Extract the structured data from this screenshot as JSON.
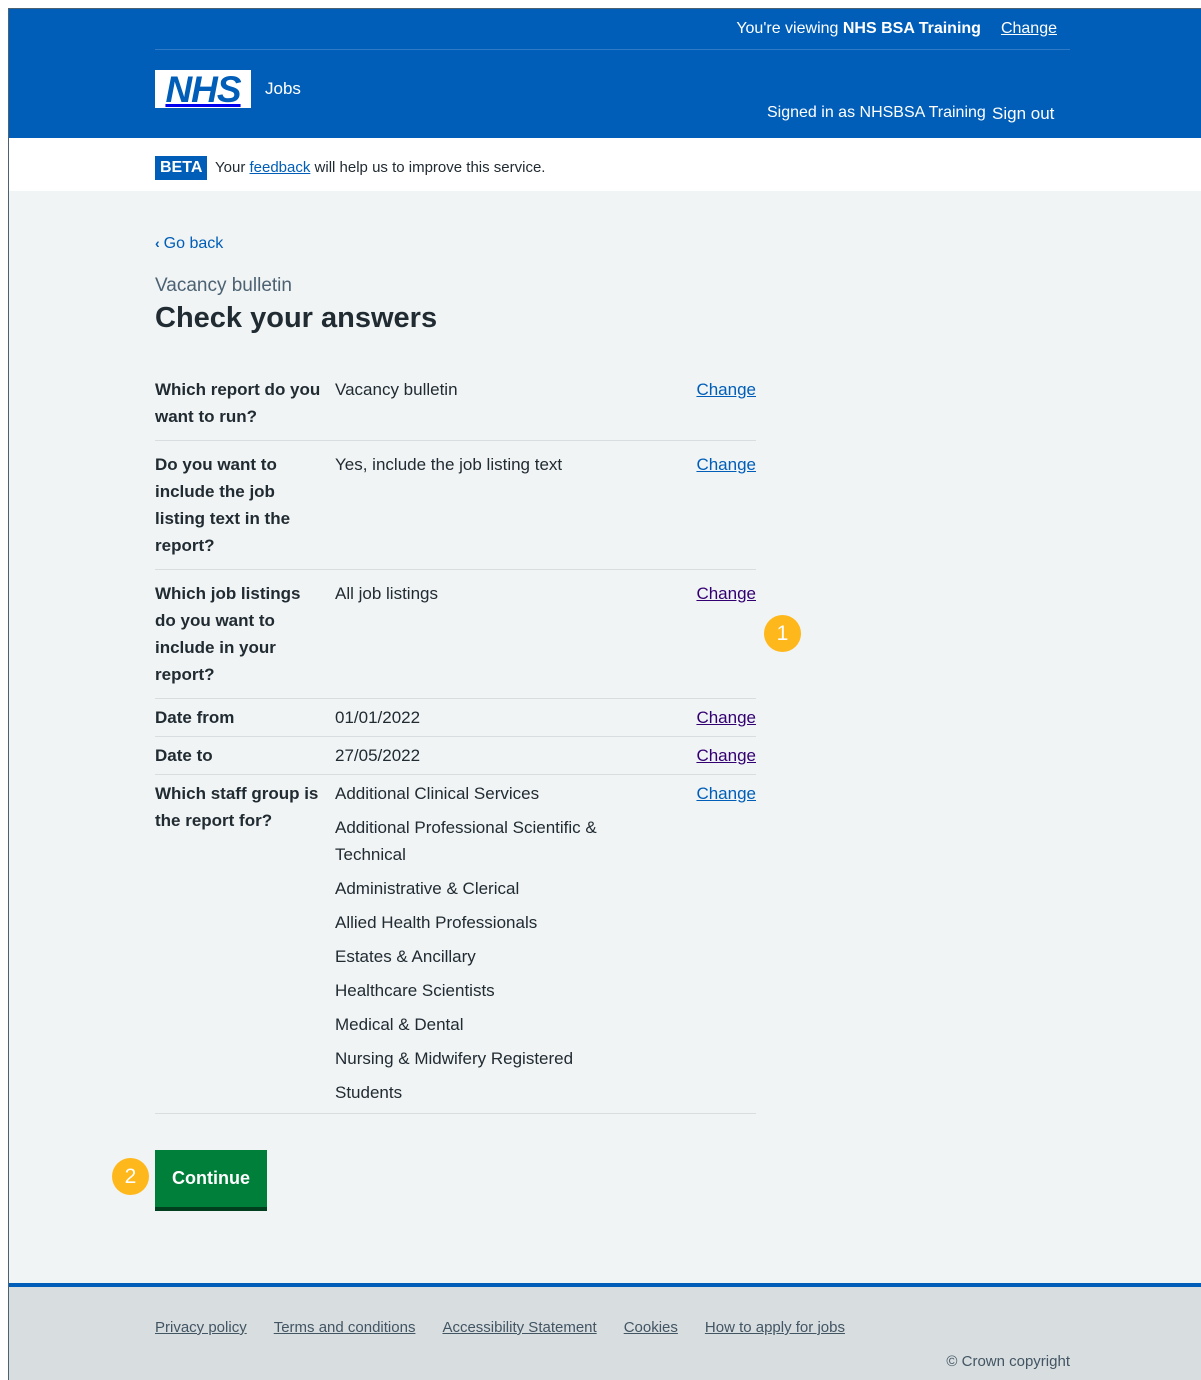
{
  "header": {
    "viewing_prefix": "You're viewing ",
    "viewing_org": "NHS BSA Training",
    "change_org_label": "Change",
    "logo_text": "NHS",
    "service_name": "Jobs",
    "signed_in": "Signed in as NHSBSA Training",
    "sign_out": "Sign out"
  },
  "beta": {
    "tag": "BETA",
    "text_before": "Your ",
    "link": "feedback",
    "text_after": " will help us to improve this service."
  },
  "main": {
    "back_link": "Go back",
    "caption": "Vacancy bulletin",
    "title": "Check your answers",
    "rows": [
      {
        "key": "Which report do you want to run?",
        "values": [
          "Vacancy bulletin"
        ],
        "action": "Change"
      },
      {
        "key": "Do you want to include the job listing text in the report?",
        "values": [
          "Yes, include the job listing text"
        ],
        "action": "Change"
      },
      {
        "key": "Which job listings do you want to include in your report?",
        "values": [
          "All job listings"
        ],
        "action": "Change"
      },
      {
        "key": "Date from",
        "values": [
          "01/01/2022"
        ],
        "action": "Change"
      },
      {
        "key": "Date to",
        "values": [
          "27/05/2022"
        ],
        "action": "Change"
      },
      {
        "key": "Which staff group is the report for?",
        "values": [
          "Additional Clinical Services",
          "Additional Professional Scientific & Technical",
          "Administrative & Clerical",
          "Allied Health Professionals",
          "Estates & Ancillary",
          "Healthcare Scientists",
          "Medical & Dental",
          "Nursing & Midwifery Registered",
          "Students"
        ],
        "action": "Change"
      }
    ],
    "continue_label": "Continue"
  },
  "markers": [
    "1",
    "2"
  ],
  "footer": {
    "links": [
      "Privacy policy",
      "Terms and conditions",
      "Accessibility Statement",
      "Cookies",
      "How to apply for jobs"
    ],
    "copyright": "© Crown copyright"
  }
}
